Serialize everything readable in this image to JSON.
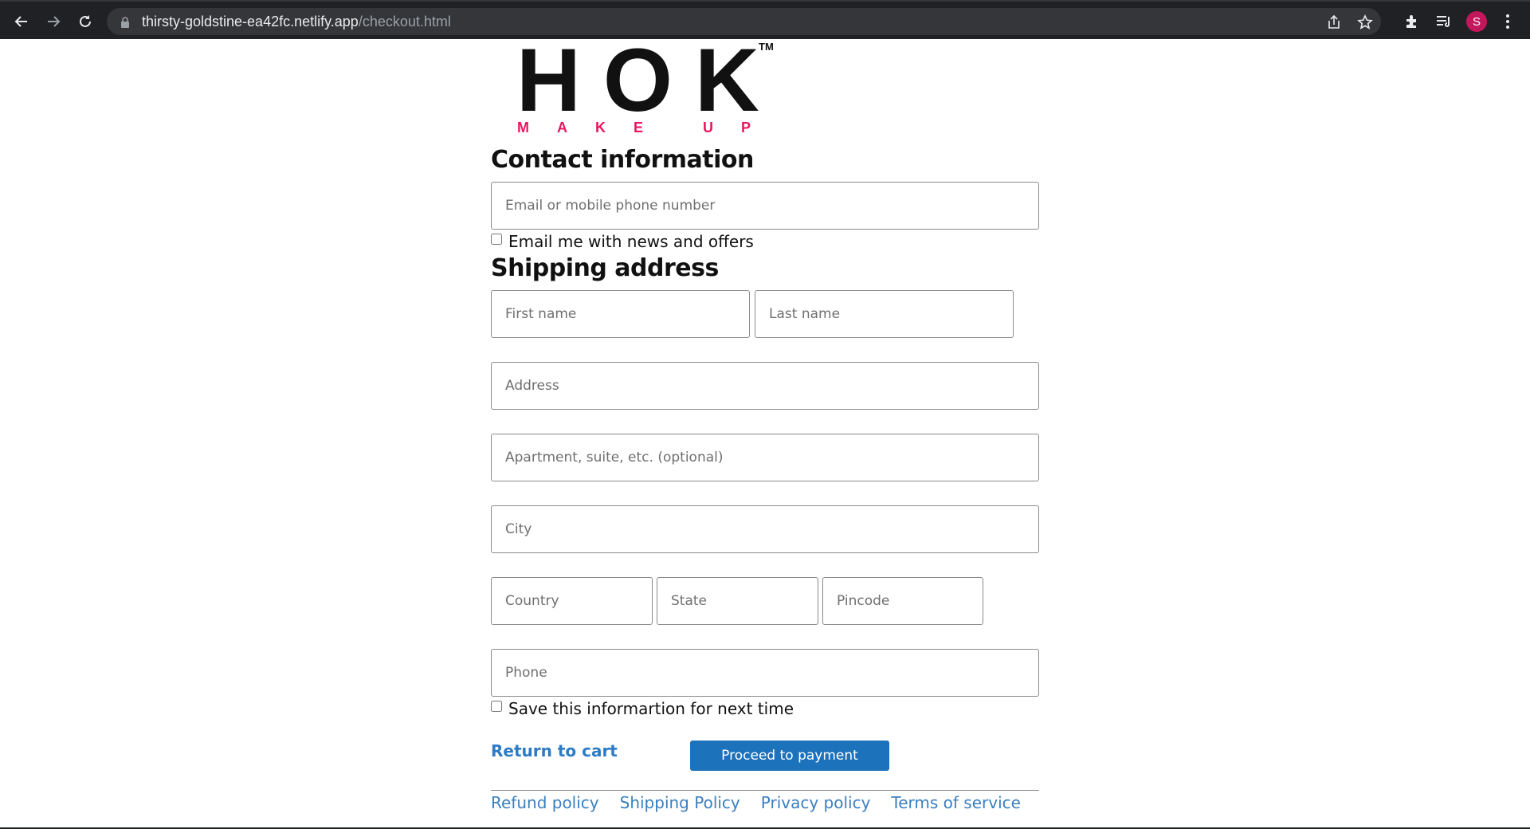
{
  "browser": {
    "url_host": "thirsty-goldstine-ea42fc.netlify.app",
    "url_path": "/checkout.html",
    "profile_initial": "S",
    "icons": [
      "back-arrow-icon",
      "forward-arrow-icon",
      "reload-icon",
      "lock-icon",
      "share-icon",
      "star-icon",
      "extensions-icon",
      "reading-list-icon",
      "more-vert-icon"
    ]
  },
  "logo": {
    "main": "HOK",
    "tm": "TM",
    "sub": "MAKE UP"
  },
  "contact": {
    "heading": "Contact information",
    "email_placeholder": "Email or mobile phone number",
    "news_label": "Email me with news and offers"
  },
  "shipping": {
    "heading": "Shipping address",
    "first_name_placeholder": "First name",
    "last_name_placeholder": "Last name",
    "address_placeholder": "Address",
    "apartment_placeholder": "Apartment, suite, etc. (optional)",
    "city_placeholder": "City",
    "country_placeholder": "Country",
    "state_placeholder": "State",
    "pincode_placeholder": "Pincode",
    "phone_placeholder": "Phone",
    "save_label": "Save this informartion for next time"
  },
  "actions": {
    "return_label": "Return to cart",
    "proceed_label": "Proceed to payment"
  },
  "footer": {
    "links": [
      "Refund policy",
      "Shipping Policy",
      "Privacy policy",
      "Terms of service"
    ]
  },
  "colors": {
    "accent": "#1d72bc",
    "link": "#3a7fc0",
    "logo_sub": "#e8175d",
    "avatar": "#c2185b"
  }
}
